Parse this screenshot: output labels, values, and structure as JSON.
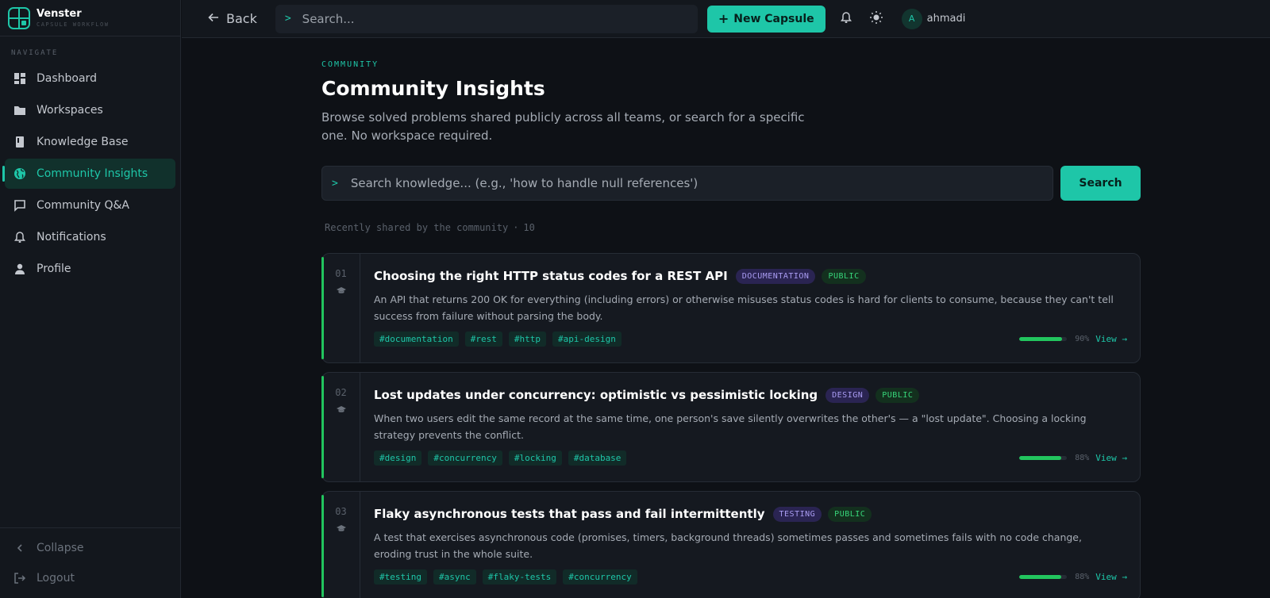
{
  "brand": {
    "name": "Venster",
    "subtitle": "CAPSULE WORKFLOW"
  },
  "sidebar": {
    "heading": "NAVIGATE",
    "items": [
      {
        "label": "Dashboard",
        "icon": "dashboard-icon"
      },
      {
        "label": "Workspaces",
        "icon": "folder-icon"
      },
      {
        "label": "Knowledge Base",
        "icon": "book-icon"
      },
      {
        "label": "Community Insights",
        "icon": "globe-icon",
        "active": true
      },
      {
        "label": "Community Q&A",
        "icon": "chat-icon"
      },
      {
        "label": "Notifications",
        "icon": "bell-icon"
      },
      {
        "label": "Profile",
        "icon": "user-icon"
      }
    ],
    "collapse_label": "Collapse",
    "logout_label": "Logout"
  },
  "topbar": {
    "back_label": "Back",
    "search_prompt": ">",
    "search_placeholder": "Search...",
    "new_button_label": "New Capsule",
    "user": {
      "initial": "A",
      "name": "ahmadi"
    }
  },
  "page": {
    "eyebrow": "COMMUNITY",
    "title": "Community Insights",
    "description": "Browse solved problems shared publicly across all teams, or search for a specific one. No workspace required.",
    "search_prompt": ">",
    "search_placeholder": "Search knowledge... (e.g., 'how to handle null references')",
    "search_button": "Search",
    "recent_label": "Recently shared by the community",
    "recent_sep": "·",
    "recent_count": "10"
  },
  "cards": [
    {
      "num": "01",
      "title": "Choosing the right HTTP status codes for a REST API",
      "category": "DOCUMENTATION",
      "visibility": "PUBLIC",
      "description": "An API that returns 200 OK for everything (including errors) or otherwise misuses status codes is hard for clients to consume, because they can't tell success from failure without parsing the body.",
      "tags": [
        "#documentation",
        "#rest",
        "#http",
        "#api-design"
      ],
      "progress": 90,
      "progress_label": "90%",
      "view_label": "View →"
    },
    {
      "num": "02",
      "title": "Lost updates under concurrency: optimistic vs pessimistic locking",
      "category": "DESIGN",
      "visibility": "PUBLIC",
      "description": "When two users edit the same record at the same time, one person's save silently overwrites the other's — a \"lost update\". Choosing a locking strategy prevents the conflict.",
      "tags": [
        "#design",
        "#concurrency",
        "#locking",
        "#database"
      ],
      "progress": 88,
      "progress_label": "88%",
      "view_label": "View →"
    },
    {
      "num": "03",
      "title": "Flaky asynchronous tests that pass and fail intermittently",
      "category": "TESTING",
      "visibility": "PUBLIC",
      "description": "A test that exercises asynchronous code (promises, timers, background threads) sometimes passes and sometimes fails with no code change, eroding trust in the whole suite.",
      "tags": [
        "#testing",
        "#async",
        "#flaky-tests",
        "#concurrency"
      ],
      "progress": 88,
      "progress_label": "88%",
      "view_label": "View →"
    }
  ],
  "colors": {
    "accent": "#1ec6a8",
    "success": "#22c55e",
    "background": "#0e1116"
  }
}
